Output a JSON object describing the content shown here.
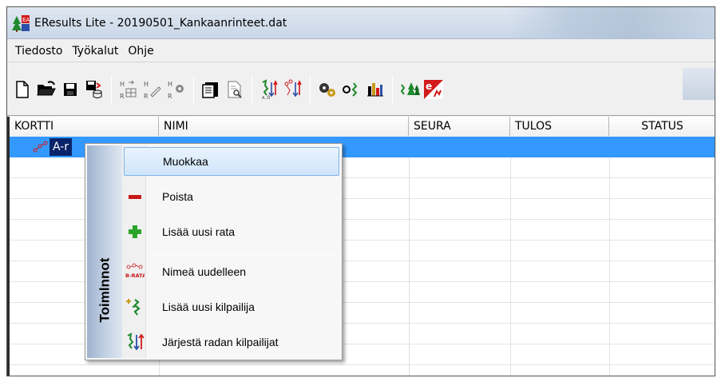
{
  "window": {
    "title": "EResults Lite - 20190501_Kankaanrinteet.dat"
  },
  "menubar": {
    "items": [
      "Tiedosto",
      "Työkalut",
      "Ohje"
    ]
  },
  "toolbar": {
    "icons": [
      "new-file-icon",
      "open-folder-icon",
      "save-icon",
      "save-db-icon",
      "grid-r-icon",
      "edit-r-icon",
      "settings-r-icon",
      "card-icon",
      "preview-icon",
      "sort-az-icon",
      "sort-map-icon",
      "gears-icon",
      "runner-icon",
      "chart-icon",
      "trees-runner-icon",
      "e-logo-icon"
    ]
  },
  "grid": {
    "columns": [
      "KORTTI",
      "NIMI",
      "SEURA",
      "TULOS",
      "STATUS"
    ],
    "selected_row_label": "A-r"
  },
  "context_menu": {
    "side_title": "Toimlnnot",
    "items": [
      {
        "label": "Muokkaa",
        "icon": "none"
      },
      {
        "label": "Poista",
        "icon": "minus-icon"
      },
      {
        "label": "Lisää uusi rata",
        "icon": "plus-icon"
      },
      {
        "label": "Nimeä uudelleen",
        "icon": "rename-course-icon"
      },
      {
        "label": "Lisää uusi kilpailija",
        "icon": "add-competitor-icon"
      },
      {
        "label": "Järjestä radan kilpailijat",
        "icon": "sort-competitors-icon"
      }
    ],
    "icon_text": {
      "rename": "B-RATA"
    }
  },
  "colors": {
    "selection": "#3399ff",
    "selection_dark": "#0a246a",
    "menu_hover": "#cfe5fb"
  }
}
